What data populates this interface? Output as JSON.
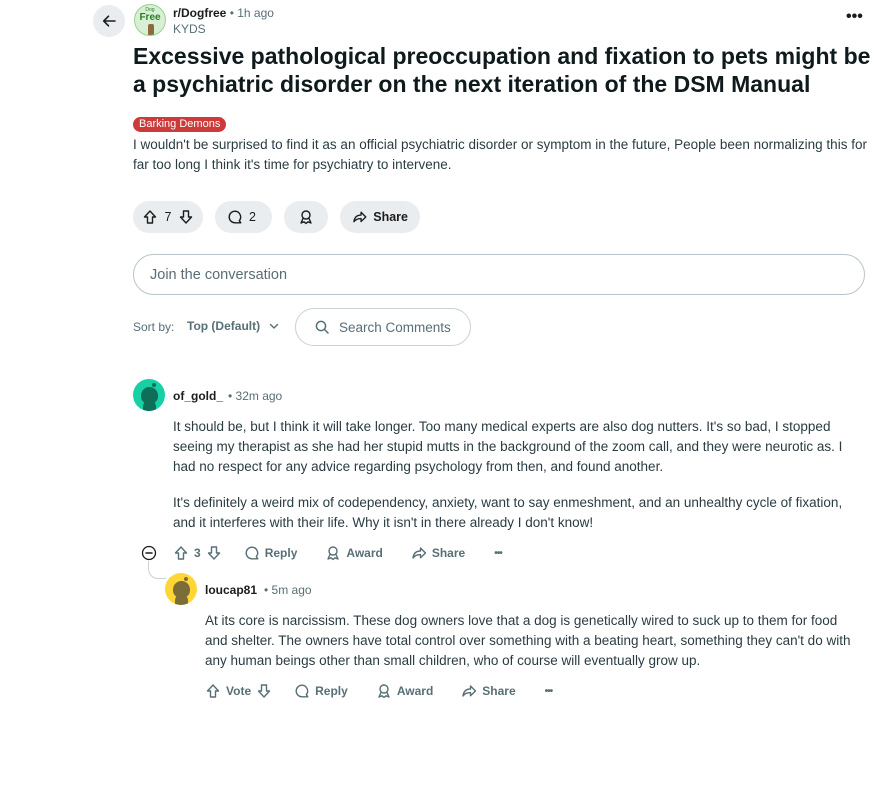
{
  "post": {
    "subreddit": "r/Dogfree",
    "separator": "•",
    "age": "1h ago",
    "author": "KYDS",
    "avatar_text_top": "Dog",
    "avatar_text": "Free",
    "title": "Excessive pathological preoccupation and fixation to pets might be a psychiatric disorder on the next iteration of the DSM Manual",
    "flair": "Barking Demons",
    "flair_color": "#cc3a3a",
    "body": "I wouldn't be surprised to find it as an official psychiatric disorder or symptom in the future, People been normalizing this for far too long I think it's time for psychiatry to intervene.",
    "score": "7",
    "comment_count": "2",
    "share_label": "Share"
  },
  "icons": {
    "back": "arrow-left-icon",
    "more": "more-horizontal-icon",
    "upvote": "arrow-up-icon",
    "downvote": "arrow-down-icon",
    "comment": "speech-bubble-icon",
    "award": "award-ribbon-icon",
    "share": "share-arrow-icon",
    "search": "search-icon",
    "chevron": "chevron-down-icon",
    "collapse": "minus-circle-icon"
  },
  "more_label": "•••",
  "compose": {
    "placeholder": "Join the conversation"
  },
  "sort": {
    "label": "Sort by:",
    "value": "Top (Default)"
  },
  "search": {
    "placeholder": "Search Comments"
  },
  "comments": [
    {
      "author": "of_gold_",
      "age": "• 32m ago",
      "avatar_color": "#17d0a5",
      "paragraphs": [
        "It should be, but I think it will take longer. Too many medical experts are also dog nutters. It's so bad, I stopped seeing my therapist as she had her stupid mutts in the background of the zoom call, and they were neurotic as. I had no respect for any advice regarding psychology from then, and found another.",
        "It's definitely a weird mix of codependency, anxiety, want to say enmeshment, and an unhealthy cycle of fixation, and it interferes with their life. Why it isn't in there already I don't know!"
      ],
      "score": "3",
      "reply_label": "Reply",
      "award_label": "Award",
      "share_label": "Share",
      "more_label": "•••"
    },
    {
      "author": "loucap81",
      "age": "• 5m ago",
      "avatar_color": "#ffd635",
      "paragraphs": [
        "At its core is narcissism. These dog owners love that a dog is genetically wired to suck up to them for food and shelter. The owners have total control over something with a beating heart, something they can't do with any human beings other than small children, who of course will eventually grow up."
      ],
      "score": "Vote",
      "reply_label": "Reply",
      "award_label": "Award",
      "share_label": "Share",
      "more_label": "•••"
    }
  ]
}
